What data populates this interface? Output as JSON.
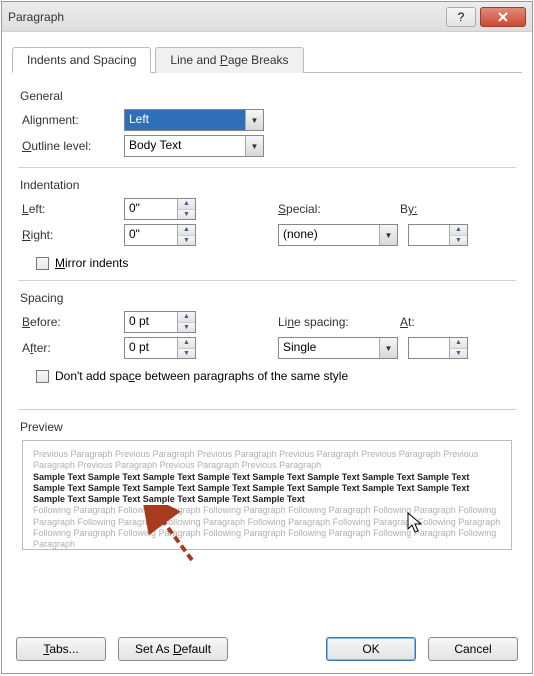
{
  "title": "Paragraph",
  "tabs": {
    "indents": "Indents and Spacing",
    "breaks_prefix": "Line and ",
    "breaks_u": "P",
    "breaks_suffix": "age Breaks"
  },
  "sections": {
    "general": "General",
    "indentation": "Indentation",
    "spacing": "Spacing",
    "preview": "Preview"
  },
  "general": {
    "alignment_label_prefix": "Ali",
    "alignment_label_u": "g",
    "alignment_label_suffix": "nment:",
    "alignment_value": "Left",
    "outline_label_u": "O",
    "outline_label_suffix": "utline level:",
    "outline_value": "Body Text"
  },
  "indentation": {
    "left_u": "L",
    "left_suffix": "eft:",
    "left_value": "0\"",
    "right_u": "R",
    "right_suffix": "ight:",
    "right_value": "0\"",
    "special_u": "S",
    "special_suffix": "pecial:",
    "special_value": "(none)",
    "by_label": "B",
    "by_suffix": "y:",
    "by_value": "",
    "mirror_u": "M",
    "mirror_suffix": "irror indents"
  },
  "spacing": {
    "before_u": "B",
    "before_suffix": "efore:",
    "before_value": "0 pt",
    "after_label": "A",
    "after_u": "f",
    "after_suffix": "ter:",
    "after_value": "0 pt",
    "line_label": "Li",
    "line_u": "n",
    "line_suffix": "e spacing:",
    "line_value": "Single",
    "at_u": "A",
    "at_suffix": "t:",
    "at_value": "",
    "no_space_prefix": "Don't add spa",
    "no_space_u": "c",
    "no_space_suffix": "e between paragraphs of the same style"
  },
  "preview": {
    "prev_para": "Previous Paragraph Previous Paragraph Previous Paragraph Previous Paragraph Previous Paragraph Previous Paragraph Previous Paragraph Previous Paragraph Previous Paragraph",
    "sample": "Sample Text Sample Text Sample Text Sample Text Sample Text Sample Text Sample Text Sample Text Sample Text Sample Text Sample Text Sample Text Sample Text Sample Text Sample Text Sample Text Sample Text Sample Text Sample Text Sample Text Sample Text",
    "following": "Following Paragraph Following Paragraph Following Paragraph Following Paragraph Following Paragraph Following Paragraph Following Paragraph Following Paragraph Following Paragraph Following Paragraph Following Paragraph Following Paragraph Following Paragraph Following Paragraph Following Paragraph Following Paragraph Following Paragraph"
  },
  "buttons": {
    "tabs_u": "T",
    "tabs_suffix": "abs...",
    "default_label": "Set As ",
    "default_u": "D",
    "default_suffix": "efault",
    "ok": "OK",
    "cancel": "Cancel"
  }
}
